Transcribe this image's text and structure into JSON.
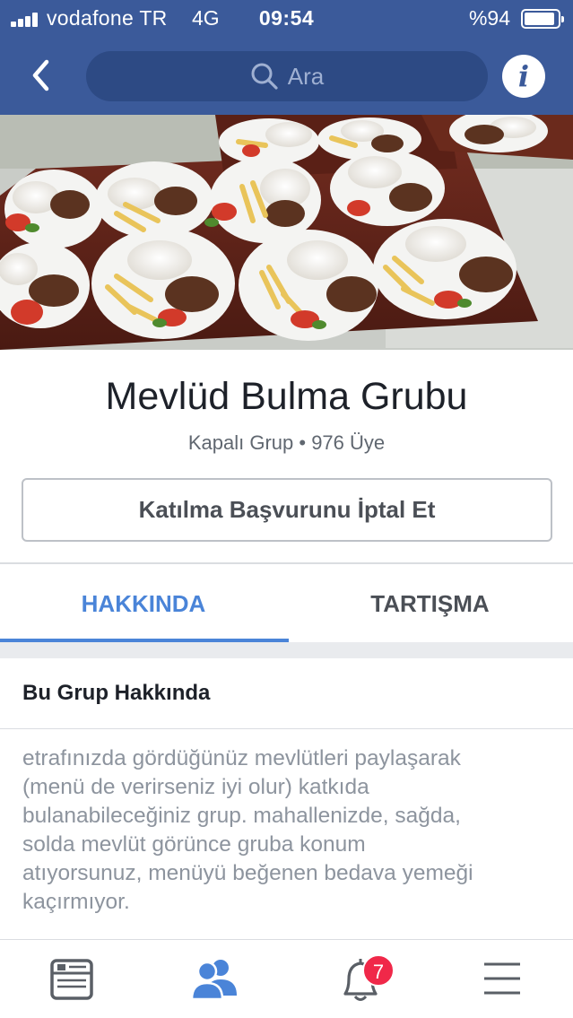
{
  "status_bar": {
    "carrier": "vodafone TR",
    "network": "4G",
    "time": "09:54",
    "battery_percent": "%94",
    "battery_level": 0.94
  },
  "nav": {
    "back_icon": "chevron-left-icon",
    "search_placeholder": "Ara",
    "info_icon": "info-icon",
    "info_glyph": "i",
    "bar_color": "#3b5a9a"
  },
  "cover": {
    "image": "plates-of-rice-meat-and-fries-photo"
  },
  "group": {
    "name": "Mevlüd Bulma Grubu",
    "meta": "Kapalı Grup • 976 Üye",
    "cancel_button": "Katılma Başvurunu İptal Et"
  },
  "tabs": [
    {
      "label": "HAKKINDA",
      "active": true
    },
    {
      "label": "TARTIŞMA",
      "active": false
    }
  ],
  "about": {
    "title": "Bu Grup Hakkında",
    "lines": [
      "etrafınızda gördüğünüz mevlütleri paylaşarak",
      "(menü de verirseniz iyi olur) katkıda",
      "bulanabileceğiniz grup. mahallenizde, sağda,",
      "solda mevlüt görünce gruba konum",
      "atıyorsunuz, menüyü beğenen bedava yemeği",
      "kaçırmıyor."
    ]
  },
  "bottom_nav": {
    "items": [
      {
        "icon": "news-feed-icon"
      },
      {
        "icon": "groups-icon",
        "active": true
      },
      {
        "icon": "notifications-bell-icon"
      },
      {
        "icon": "menu-icon"
      }
    ],
    "notification_count": "7",
    "accent": "#4a84d8",
    "badge_color": "#f02849"
  }
}
